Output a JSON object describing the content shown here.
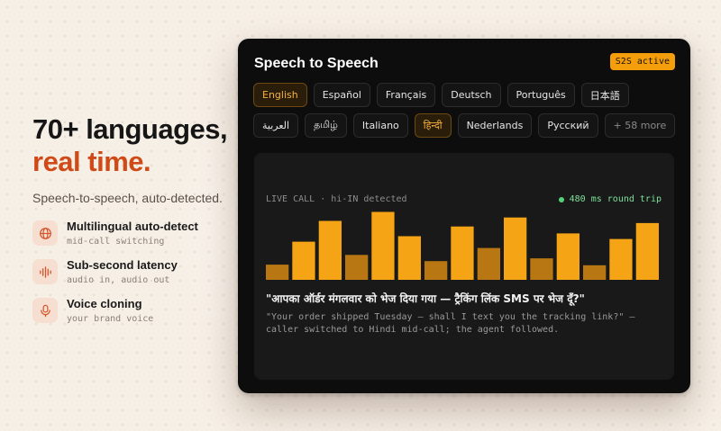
{
  "hero": {
    "headline_line1": "70+ languages,",
    "headline_line2": "real time.",
    "subtitle": "Speech-to-speech, auto-detected."
  },
  "features": [
    {
      "icon": "globe-icon",
      "title": "Multilingual auto-detect",
      "subtitle": "mid-call switching"
    },
    {
      "icon": "waveform-icon",
      "title": "Sub-second latency",
      "subtitle": "audio in, audio out"
    },
    {
      "icon": "microphone-icon",
      "title": "Voice cloning",
      "subtitle": "your brand voice"
    }
  ],
  "panel": {
    "title": "Speech to Speech",
    "badge": "S2S active",
    "languages": [
      {
        "label": "English",
        "selected": true
      },
      {
        "label": "Español",
        "selected": false
      },
      {
        "label": "Français",
        "selected": false
      },
      {
        "label": "Deutsch",
        "selected": false
      },
      {
        "label": "Português",
        "selected": false
      },
      {
        "label": "日本語",
        "selected": false
      },
      {
        "label": "العربية",
        "selected": false
      },
      {
        "label": "தமிழ்",
        "selected": false
      },
      {
        "label": "Italiano",
        "selected": false
      },
      {
        "label": "हिन्दी",
        "selected": true
      },
      {
        "label": "Nederlands",
        "selected": false
      },
      {
        "label": "Русский",
        "selected": false
      },
      {
        "label": "+ 58 more",
        "selected": false,
        "more": true
      }
    ],
    "call": {
      "status": "LIVE CALL · hi-IN detected",
      "latency": "480 ms round trip",
      "levels": [
        0.22,
        0.55,
        0.85,
        0.36,
        0.98,
        0.63,
        0.27,
        0.77,
        0.46,
        0.9,
        0.31,
        0.67,
        0.21,
        0.59,
        0.82
      ],
      "transcript": "\"आपका ऑर्डर मंगलवार को भेज दिया गया — ट्रैकिंग लिंक SMS पर भेज दूँ?\"",
      "translation": "\"Your order shipped Tuesday — shall I text you the tracking link?\" — caller switched to Hindi mid-call; the agent followed."
    }
  },
  "colors": {
    "accent": "#cf4a16",
    "bar_bright": "#f4a414",
    "bar_dim": "#b87712",
    "live": "#54d17a"
  }
}
